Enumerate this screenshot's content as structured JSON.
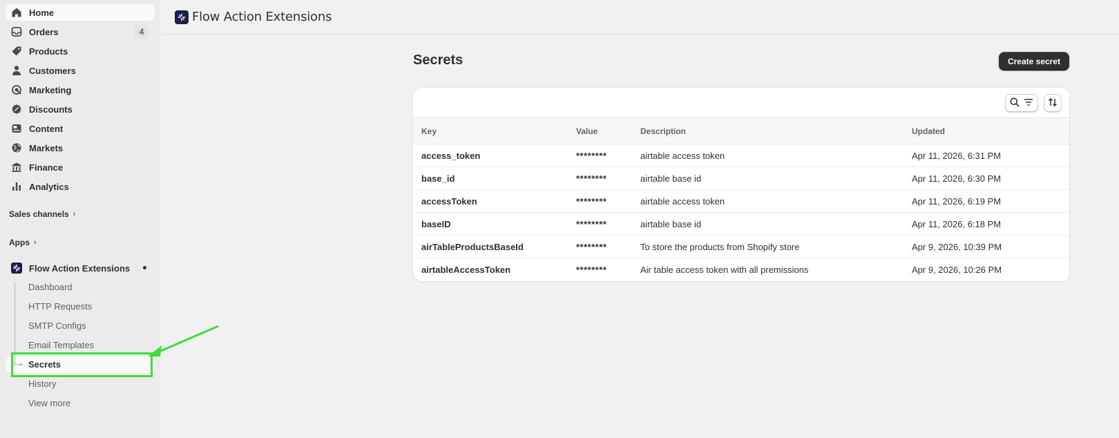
{
  "sidebar": {
    "nav": [
      {
        "label": "Home",
        "icon": "home-icon"
      },
      {
        "label": "Orders",
        "icon": "inbox-icon",
        "badge": "4"
      },
      {
        "label": "Products",
        "icon": "tag-icon"
      },
      {
        "label": "Customers",
        "icon": "person-icon"
      },
      {
        "label": "Marketing",
        "icon": "target-icon"
      },
      {
        "label": "Discounts",
        "icon": "discount-icon"
      },
      {
        "label": "Content",
        "icon": "content-icon"
      },
      {
        "label": "Markets",
        "icon": "globe-icon"
      },
      {
        "label": "Finance",
        "icon": "bank-icon"
      },
      {
        "label": "Analytics",
        "icon": "bar-chart-icon"
      }
    ],
    "sales_channels": "Sales channels",
    "apps": "Apps",
    "app_name": "Flow Action Extensions",
    "sub_items": [
      "Dashboard",
      "HTTP Requests",
      "SMTP Configs",
      "Email Templates",
      "Secrets",
      "History",
      "View more"
    ]
  },
  "topbar": {
    "title": "Flow Action Extensions"
  },
  "main": {
    "title": "Secrets",
    "create_button": "Create secret",
    "columns": [
      "Key",
      "Value",
      "Description",
      "Updated"
    ],
    "rows": [
      {
        "key": "access_token",
        "value": "********",
        "description": "airtable access token",
        "updated": "Apr 11, 2026, 6:31 PM"
      },
      {
        "key": "base_id",
        "value": "********",
        "description": "airtable base id",
        "updated": "Apr 11, 2026, 6:30 PM"
      },
      {
        "key": "accessToken",
        "value": "********",
        "description": "airtable access token",
        "updated": "Apr 11, 2026, 6:19 PM"
      },
      {
        "key": "baseID",
        "value": "********",
        "description": "airtable base id",
        "updated": "Apr 11, 2026, 6:18 PM"
      },
      {
        "key": "airTableProductsBaseId",
        "value": "********",
        "description": "To store the products from Shopify store",
        "updated": "Apr 9, 2026, 10:39 PM"
      },
      {
        "key": "airtableAccessToken",
        "value": "********",
        "description": "Air table access token with all premissions",
        "updated": "Apr 9, 2026, 10:26 PM"
      }
    ]
  },
  "colors": {
    "annotation": "#3ddc3d",
    "primary_button": "#303030",
    "app_logo": "#1c1e4a"
  }
}
